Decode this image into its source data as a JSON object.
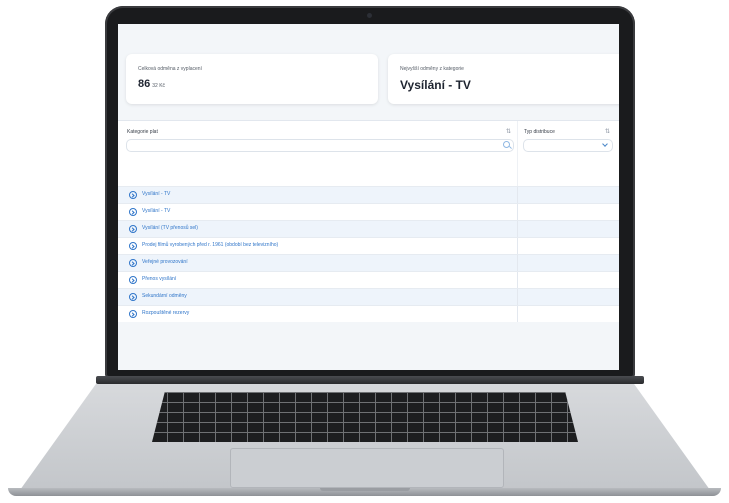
{
  "summary": {
    "total_label": "Celková odměna z vyplacení",
    "total_value": "86",
    "total_unit": "32 Kč",
    "top_category_label": "Nejvyšší odměny z kategorie",
    "top_category_value": "Vysílání - TV"
  },
  "filters": {
    "category_header": "Kategorie plat",
    "distribution_header": "Typ distribuce",
    "search_placeholder": ""
  },
  "rows": [
    {
      "label": "Vysílání - TV"
    },
    {
      "label": "Vysílání - TV"
    },
    {
      "label": "Vysílání (TV přenosů sel)"
    },
    {
      "label": "Prodej filmů vyrobených před r. 1961 (období bez televizního)"
    },
    {
      "label": "Veřejné provozování"
    },
    {
      "label": "Přenos vysílání"
    },
    {
      "label": "Sekundární odměny"
    },
    {
      "label": "Rozpouštěné rezervy"
    }
  ],
  "icons": {
    "search": "search-icon",
    "filter": "filter-icon",
    "dropdown": "chevron-down-icon",
    "row_expand": "chevron-right-circle-icon"
  },
  "colors": {
    "accent": "#2f75c9",
    "row_alt": "#eef4fb"
  }
}
